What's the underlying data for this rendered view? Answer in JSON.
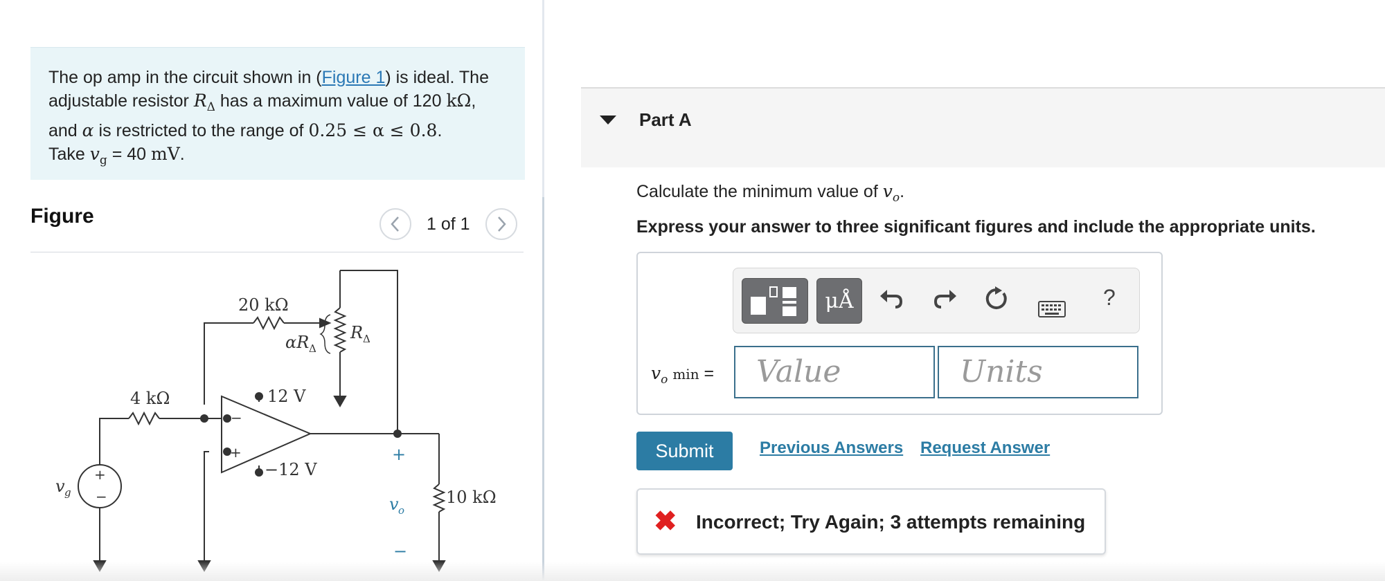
{
  "problem": {
    "text_1": "The op amp in the circuit shown in (",
    "figure_link": "Figure 1",
    "text_2": ") is ideal. The adjustable resistor ",
    "r_delta": "R",
    "r_delta_sub": "Δ",
    "text_3": " has a maximum value of 120 ",
    "unit_kohm": "kΩ",
    "text_4": ", and ",
    "alpha": "α",
    "text_5": " is restricted to the range of ",
    "range": "0.25 ≤ α ≤ 0.8",
    "text_6": ".",
    "text_7": "Take ",
    "vg": "v",
    "vg_sub": "g",
    "text_8": " = 40 ",
    "vg_unit": "mV",
    "text_9": "."
  },
  "figure": {
    "title": "Figure",
    "counter": "1 of 1",
    "prev_icon": "chevron-left-icon",
    "next_icon": "chevron-right-icon",
    "labels": {
      "r20k": "20 kΩ",
      "alpha_r": "αR",
      "alpha_r_sub": "Δ",
      "r_delta": "R",
      "r_delta_sub": "Δ",
      "r4k": "4 kΩ",
      "plus12": "12 V",
      "minus12": "−12 V",
      "vg": "v",
      "vg_sub": "g",
      "vo": "v",
      "vo_sub": "o",
      "r10k": "10 kΩ",
      "plus": "+",
      "minus": "−",
      "src_plus": "+",
      "src_minus": "−",
      "opamp_minus": "−",
      "opamp_plus": "+"
    }
  },
  "part": {
    "caret_icon": "caret-down-icon",
    "title": "Part A",
    "question_text": "Calculate the minimum value of ",
    "question_var": "v",
    "question_var_sub": "o",
    "question_end": ".",
    "instructions": "Express your answer to three significant figures and include the appropriate units."
  },
  "toolbar": {
    "template_icon": "template-icon",
    "units_button": "μÅ",
    "undo_icon": "undo-icon",
    "redo_icon": "redo-icon",
    "reset_icon": "reset-icon",
    "keyboard_icon": "keyboard-icon",
    "help": "?"
  },
  "answer": {
    "var": "v",
    "var_sub": "o",
    "var_qual": "min",
    "equals": "=",
    "value_placeholder": "Value",
    "units_placeholder": "Units"
  },
  "actions": {
    "submit": "Submit",
    "previous_answers": "Previous Answers",
    "request_answer": "Request Answer"
  },
  "feedback": {
    "icon": "x-icon",
    "message": "Incorrect; Try Again; 3 attempts remaining"
  }
}
